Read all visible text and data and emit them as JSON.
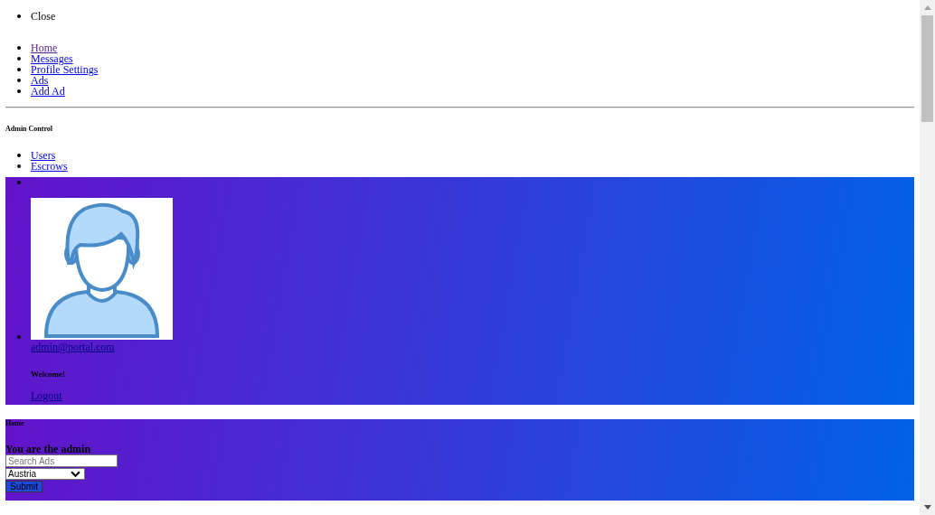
{
  "close": "Close",
  "nav": [
    {
      "label": "Home",
      "visited": true
    },
    {
      "label": "Messages",
      "visited": false
    },
    {
      "label": "Profile Settings",
      "visited": false
    },
    {
      "label": "Ads",
      "visited": false
    },
    {
      "label": "Add Ad",
      "visited": false
    }
  ],
  "admin_heading": "Admin Control",
  "admin_links": [
    "Users",
    "Escrows"
  ],
  "profile": {
    "email": "admin@portal.com",
    "greeting": "Welcome!",
    "logout": "Logout"
  },
  "page_title": "Home",
  "banner": {
    "heading": "You are the admin",
    "search": {
      "placeholder": "Search Ads"
    },
    "country": "Austria",
    "submit": "Submit"
  }
}
